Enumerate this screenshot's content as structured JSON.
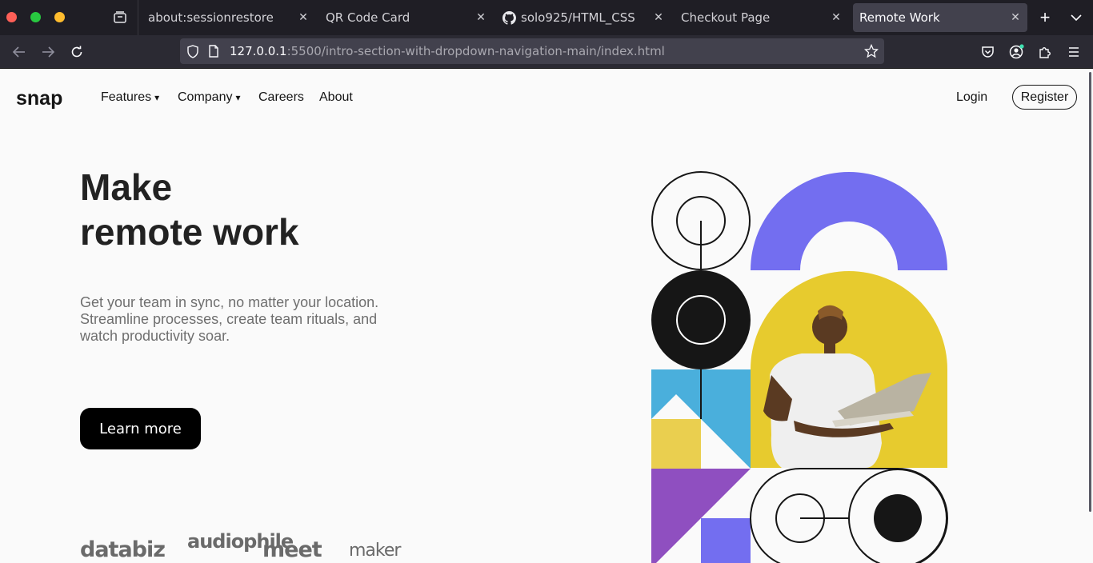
{
  "browser": {
    "tabs": [
      {
        "label": "about:sessionrestore",
        "active": false
      },
      {
        "label": "QR Code Card",
        "active": false
      },
      {
        "label": "solo925/HTML_CSS",
        "active": false,
        "icon": "github-icon"
      },
      {
        "label": "Checkout Page",
        "active": false
      },
      {
        "label": "Remote Work",
        "active": true
      }
    ],
    "url": {
      "host": "127.0.0.1",
      "rest": ":5500/intro-section-with-dropdown-navigation-main/index.html"
    }
  },
  "site": {
    "logo": "snap",
    "nav": {
      "features": "Features",
      "company": "Company",
      "careers": "Careers",
      "about": "About",
      "caret": "▾"
    },
    "login": "Login",
    "register": "Register",
    "hero": {
      "title_line1": "Make",
      "title_line2": "remote work",
      "text": "Get your team in sync, no matter your location. Streamline processes, create team rituals, and watch productivity soar.",
      "cta": "Learn more"
    },
    "clients": [
      "databiz",
      "audiophile",
      "meet",
      "maker"
    ]
  },
  "colors": {
    "purple": "#736ef0",
    "yellow": "#eac92f",
    "blue": "#4aafdc",
    "violet": "#8f4fc0",
    "black": "#161616"
  }
}
